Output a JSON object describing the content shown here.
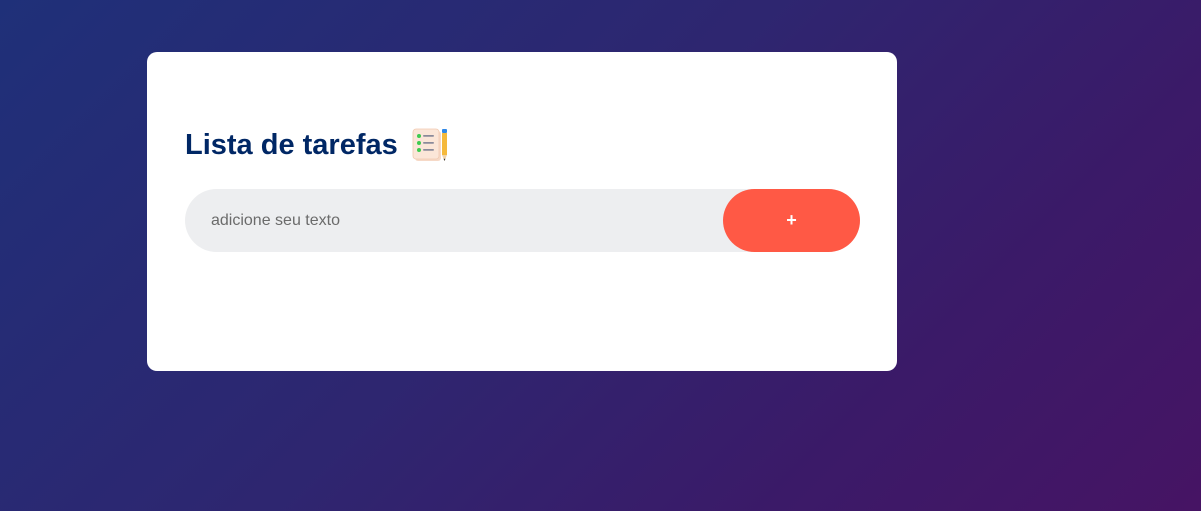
{
  "app": {
    "title": "Lista de tarefas",
    "title_icon": "notepad-checklist-pencil-icon"
  },
  "form": {
    "input_value": "",
    "input_placeholder": "adicione seu texto",
    "add_button_label": "+"
  },
  "colors": {
    "title": "#002765",
    "accent": "#ff5945",
    "input_bg": "#edeef0",
    "card_bg": "#ffffff",
    "background_start": "#1f3079",
    "background_end": "#461464"
  }
}
